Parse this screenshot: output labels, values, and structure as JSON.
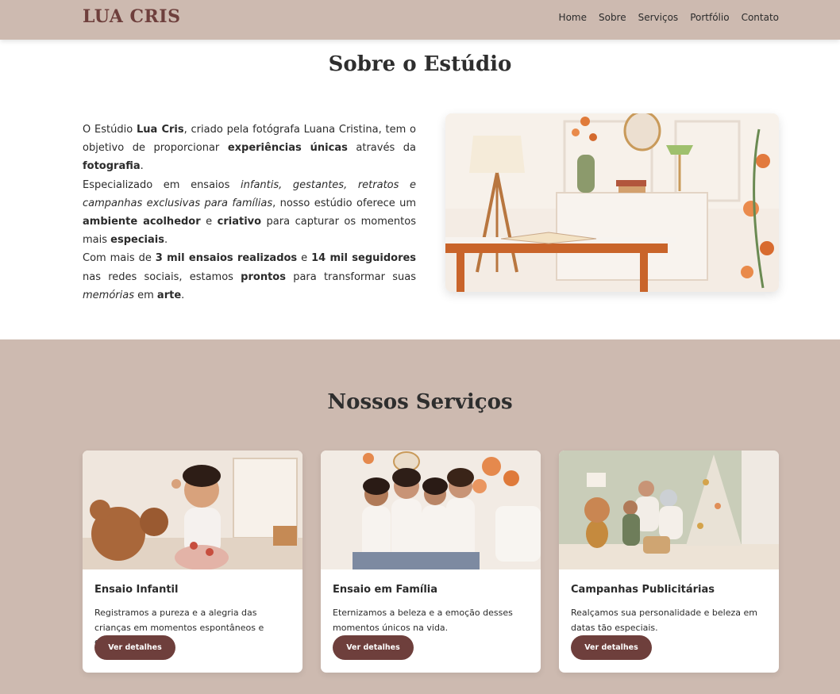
{
  "header": {
    "logo": "LUA CRIS",
    "nav": [
      {
        "label": "Home"
      },
      {
        "label": "Sobre"
      },
      {
        "label": "Serviços"
      },
      {
        "label": "Portfólio"
      },
      {
        "label": "Contato"
      }
    ]
  },
  "about": {
    "title": "Sobre o Estúdio",
    "image": {
      "icon": "studio-desk-photo"
    }
  },
  "services": {
    "title": "Nossos Serviços",
    "cards": [
      {
        "title": "Ensaio Infantil",
        "description": "Registramos a pureza e a alegria das crianças em momentos espontâneos e divertidos.",
        "button": "Ver detalhes",
        "icon": "child-photo"
      },
      {
        "title": "Ensaio em Família",
        "description": "Eternizamos a beleza e a emoção desses momentos únicos na vida.",
        "button": "Ver detalhes",
        "icon": "family-photo"
      },
      {
        "title": "Campanhas Publicitárias",
        "description": "Realçamos sua personalidade e beleza em datas tão especiais.",
        "button": "Ver detalhes",
        "icon": "christmas-campaign-photo"
      }
    ]
  },
  "colors": {
    "brand": "#6e3f3c",
    "header_bg": "#cdbab0",
    "section_bg": "#cdbab0"
  }
}
